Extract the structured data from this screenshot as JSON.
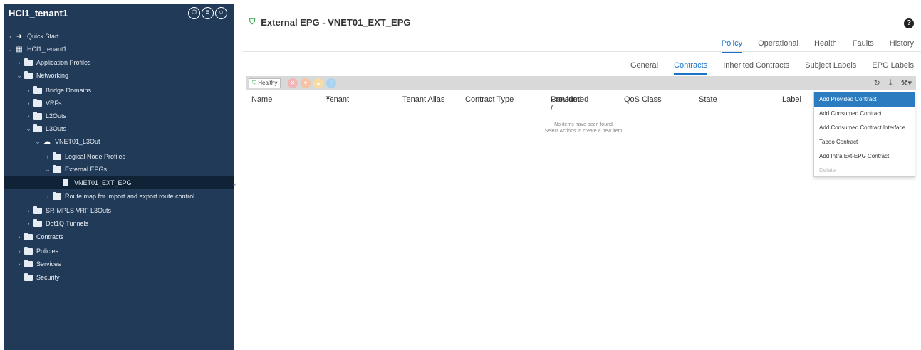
{
  "sidebar": {
    "title": "HCI1_tenant1",
    "tree": [
      {
        "label": "Quick Start",
        "chev": "›",
        "icon": "quick-start-icon"
      },
      {
        "label": "HCI1_tenant1",
        "chev": "⌄",
        "icon": "tenant-icon"
      },
      {
        "label": "Application Profiles",
        "chev": "›",
        "icon": "folder-icon"
      },
      {
        "label": "Networking",
        "chev": "⌄",
        "icon": "folder-icon"
      },
      {
        "label": "Bridge Domains",
        "chev": "›",
        "icon": "folder-icon"
      },
      {
        "label": "VRFs",
        "chev": "›",
        "icon": "folder-icon"
      },
      {
        "label": "L2Outs",
        "chev": "›",
        "icon": "folder-icon"
      },
      {
        "label": "L3Outs",
        "chev": "⌄",
        "icon": "folder-icon"
      },
      {
        "label": "VNET01_L3Out",
        "chev": "⌄",
        "icon": "cloud-icon"
      },
      {
        "label": "Logical Node Profiles",
        "chev": "›",
        "icon": "folder-icon"
      },
      {
        "label": "External EPGs",
        "chev": "⌄",
        "icon": "folder-icon"
      },
      {
        "label": "VNET01_EXT_EPG",
        "chev": "",
        "icon": "document-icon"
      },
      {
        "label": "Route map for import and export route control",
        "chev": "›",
        "icon": "folder-icon"
      },
      {
        "label": "SR-MPLS VRF L3Outs",
        "chev": "›",
        "icon": "folder-icon"
      },
      {
        "label": "Dot1Q Tunnels",
        "chev": "›",
        "icon": "folder-icon"
      },
      {
        "label": "Contracts",
        "chev": "›",
        "icon": "folder-icon"
      },
      {
        "label": "Policies",
        "chev": "›",
        "icon": "folder-icon"
      },
      {
        "label": "Services",
        "chev": "›",
        "icon": "folder-icon"
      },
      {
        "label": "Security",
        "chev": "",
        "icon": "folder-icon"
      }
    ]
  },
  "header": {
    "title": "External EPG - VNET01_EXT_EPG"
  },
  "tabs_primary": [
    "Policy",
    "Operational",
    "Health",
    "Faults",
    "History"
  ],
  "tabs_secondary": [
    "General",
    "Contracts",
    "Inherited Contracts",
    "Subject Labels",
    "EPG Labels"
  ],
  "toolbar": {
    "health_label": "Healthy"
  },
  "table": {
    "columns": [
      "Name",
      "Tenant",
      "Tenant Alias",
      "Contract Type",
      "Provided /",
      "Consumed",
      "QoS Class",
      "State",
      "Label"
    ],
    "empty_line1": "No items have been found.",
    "empty_line2": "Select Actions to create a new item."
  },
  "menu": {
    "items": [
      "Add Provided Contract",
      "Add Consumed Contract",
      "Add Consumed Contract Interface",
      "Taboo Contract",
      "Add Intra Ext-EPG Contract",
      "Delete"
    ]
  },
  "colors": {
    "sidebar_bg": "#213a57",
    "accent": "#1a73c9",
    "menu_active": "#2a7bc0",
    "healthy": "#3aa651"
  }
}
